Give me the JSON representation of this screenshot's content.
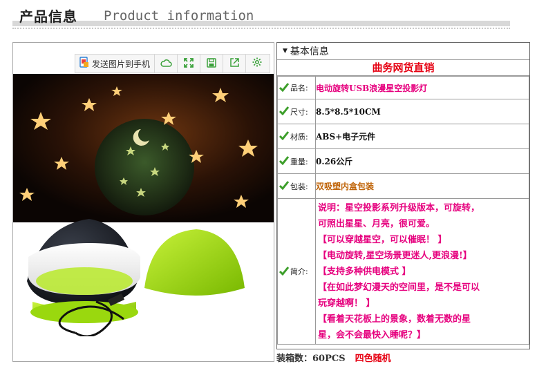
{
  "header": {
    "title_cn": "产品信息",
    "title_en": "Product information"
  },
  "toolbar": {
    "send_label": "发送图片到手机",
    "icons": [
      "phone-image-icon",
      "cloud-icon",
      "fullscreen-icon",
      "save-icon",
      "share-icon",
      "settings-icon"
    ]
  },
  "photo": {
    "alt_icon": "star-projector-lamp-photo"
  },
  "info": {
    "section_title": "基本信息",
    "banner": "曲务网货直销",
    "rows": [
      {
        "label": "品名:",
        "value": "电动旋转USB浪漫星空投影灯"
      },
      {
        "label": "尺寸:",
        "value": "8.5*8.5*10CM"
      },
      {
        "label": "材质:",
        "value": "ABS+电子元件"
      },
      {
        "label": "重量:",
        "value": "0.26公斤"
      },
      {
        "label": "包装:",
        "value": "双吸塑内盒包装"
      },
      {
        "label": "简介:"
      }
    ],
    "intro_lines": [
      "说明：星空投影系列升级版本，可旋转，",
      "可照出星星、月亮，很可爱。",
      "【可以穿越星空，可以催眠！ 】",
      "【电动旋转,星空场景更迷人,更浪漫!】",
      "【支持多种供电模式 】",
      "【在如此梦幻漫天的空间里，是不是可以",
      "玩穿越啊！ 】",
      "【看着天花板上的景象，数着无数的星",
      "星，会不会最快入睡呢？】"
    ]
  },
  "footer": {
    "carton_label": "装箱数：60PCS",
    "color_note": "四色随机"
  },
  "colors": {
    "accent_red": "#e60012",
    "magenta": "#e6007e",
    "check_green": "#3c9e2a",
    "lamp_green": "#9ad80e"
  }
}
